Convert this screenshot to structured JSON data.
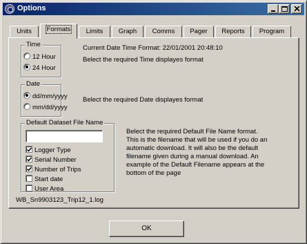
{
  "window": {
    "title": "Options"
  },
  "tabs": [
    {
      "label": "Units"
    },
    {
      "label": "Formats",
      "active": true
    },
    {
      "label": "Limits"
    },
    {
      "label": "Graph"
    },
    {
      "label": "Comms"
    },
    {
      "label": "Pager"
    },
    {
      "label": "Reports"
    },
    {
      "label": "Program"
    }
  ],
  "time": {
    "legend": "Time",
    "options": [
      {
        "label": "12 Hour",
        "selected": false
      },
      {
        "label": "24 Hour",
        "selected": true
      }
    ],
    "current_format": "Current Date Time Format: 22/01/2001 20:48:10",
    "description": "Belect the required Time displayes format"
  },
  "date": {
    "legend": "Date",
    "options": [
      {
        "label": "dd/mm/yyyy",
        "selected": true
      },
      {
        "label": "mm/dd/yyyy",
        "selected": false
      }
    ],
    "description": "Belect the required Date displayes format"
  },
  "dataset": {
    "legend": "Default Dataset File Name",
    "input_value": "",
    "options": [
      {
        "label": "Logger Type",
        "checked": true
      },
      {
        "label": "Serial Number",
        "checked": true
      },
      {
        "label": "Number of Trips",
        "checked": true
      },
      {
        "label": "Start date",
        "checked": false
      },
      {
        "label": "User Area",
        "checked": false
      }
    ],
    "example_filename": "WB_Sn9903123_Trip12_1.log",
    "description": "Belect the required Default File Name format. This is the filename that will be used if you do an automatic download. It will also be the default filename given during a manual download. An example of the Default Filename appears at the bottom of the page"
  },
  "buttons": {
    "ok_label": "OK"
  }
}
